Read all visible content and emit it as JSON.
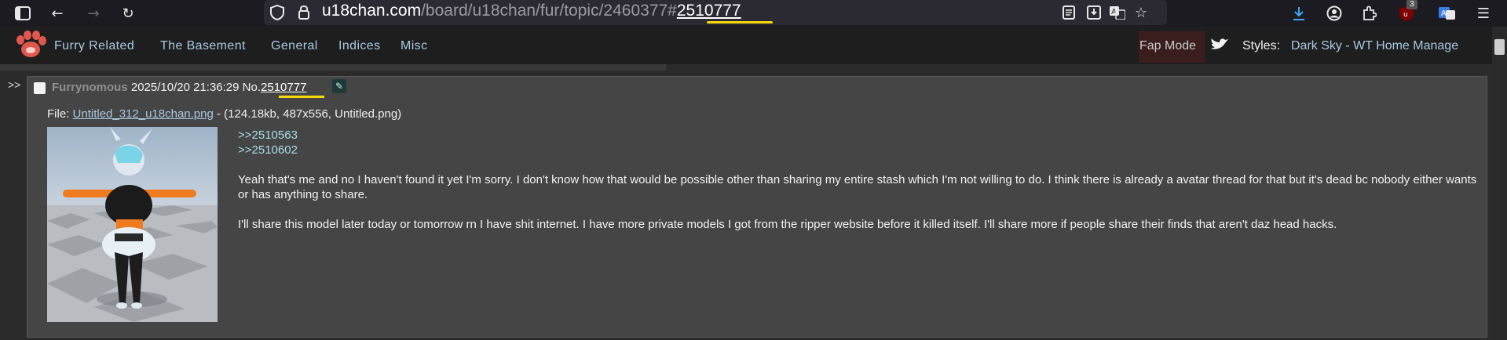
{
  "browser": {
    "url_domain": "u18chan.com",
    "url_path": "/board/u18chan/fur/topic/2460377#",
    "url_hash": "2510777",
    "notification_badge": "3"
  },
  "nav": {
    "links": [
      "Furry Related",
      "The Basement",
      "General",
      "Indices",
      "Misc"
    ],
    "fap_mode": "Fap Mode",
    "styles_label": "Styles:",
    "styles_value": "Dark Sky - WT Home Manage"
  },
  "post": {
    "arrows": ">>",
    "author": "Furrynomous",
    "datetime": "2025/10/20 21:36:29",
    "no_prefix": "No.",
    "number": "2510777",
    "file_label": "File:",
    "file_name": "Untitled_312_u18chan.png",
    "file_info": "- (124.18kb, 487x556, Untitled.png)",
    "quotes": [
      ">>2510563",
      ">>2510602"
    ],
    "paragraphs": [
      "Yeah that's me and no I haven't found it yet I'm sorry. I don't know how that would be possible other than sharing my entire stash which I'm not willing to do. I think there is already a avatar thread for that but it's dead bc nobody either wants or has anything to share.",
      "I'll share this model later today or tomorrow rn I have shit internet. I have more private models I got from the ripper website before it killed itself. I'll share more if people share their finds that aren't daz head hacks."
    ]
  },
  "colors": {
    "accent_link": "#a9c8e3",
    "quote": "#a9dcea",
    "highlight": "#f5d90a",
    "logo_red": "#e0574d"
  }
}
